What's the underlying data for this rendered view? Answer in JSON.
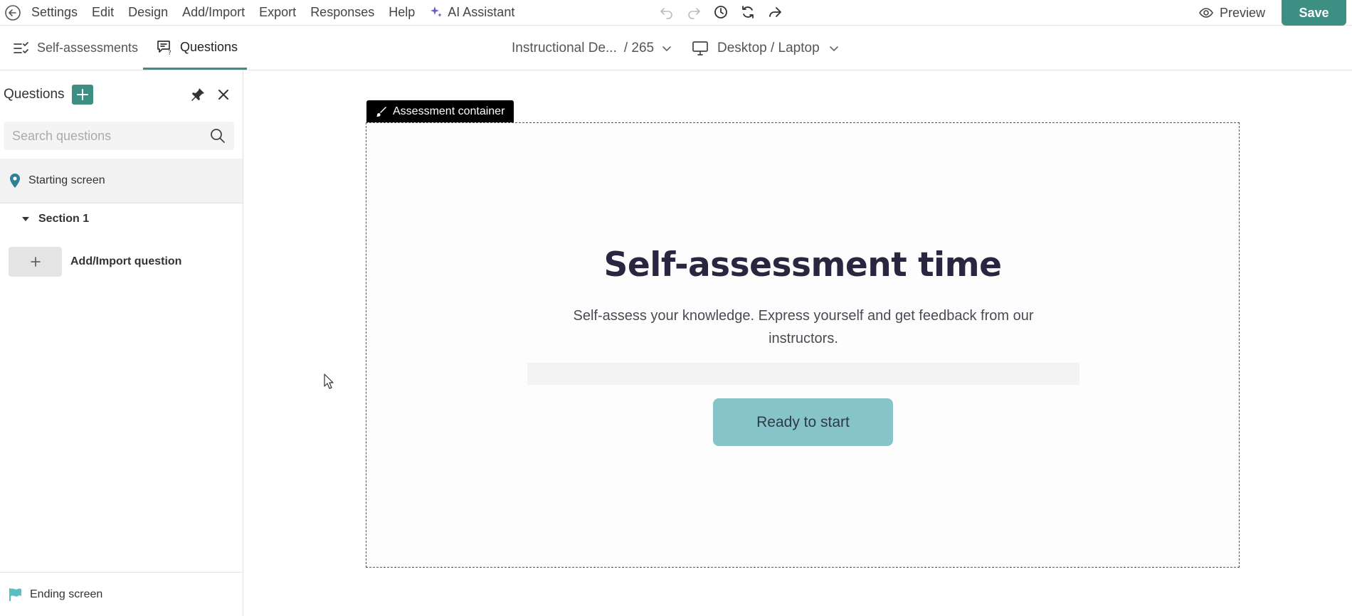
{
  "menubar": {
    "items": [
      "Settings",
      "Edit",
      "Design",
      "Add/Import",
      "Export",
      "Responses",
      "Help"
    ],
    "ai_label": "AI Assistant",
    "preview_label": "Preview",
    "save_label": "Save"
  },
  "tabs": {
    "self_assessments": "Self-assessments",
    "questions": "Questions"
  },
  "document": {
    "name": "Instructional De...",
    "count": "/ 265"
  },
  "device": {
    "label": "Desktop / Laptop"
  },
  "sidebar": {
    "title": "Questions",
    "search_placeholder": "Search questions",
    "starting_screen": "Starting screen",
    "section": "Section 1",
    "add_import": "Add/Import question",
    "ending_screen": "Ending screen"
  },
  "canvas": {
    "container_label": "Assessment container",
    "title": "Self-assessment time",
    "subtitle": "Self-assess your knowledge. Express yourself and get feedback from our instructors.",
    "start_button": "Ready to start"
  },
  "colors": {
    "accent": "#3d8f84",
    "start_button": "#86c4c9",
    "title": "#2b2540",
    "ai_icon": "#6a5acd",
    "pin_icon": "#2f7f95",
    "flag_icon": "#5bbfc1"
  },
  "icons": {
    "back": "back-arrow-icon",
    "ai": "sparkle-icon",
    "undo": "undo-icon",
    "redo": "redo-icon",
    "history": "clock-icon",
    "sync": "sync-icon",
    "share": "share-icon",
    "preview": "eye-icon",
    "self_tab": "checklist-icon",
    "questions_tab": "question-chat-icon",
    "device": "monitor-icon",
    "pin": "pin-icon",
    "close": "close-icon",
    "search": "search-icon",
    "starting": "map-pin-icon",
    "ending": "flag-icon"
  }
}
